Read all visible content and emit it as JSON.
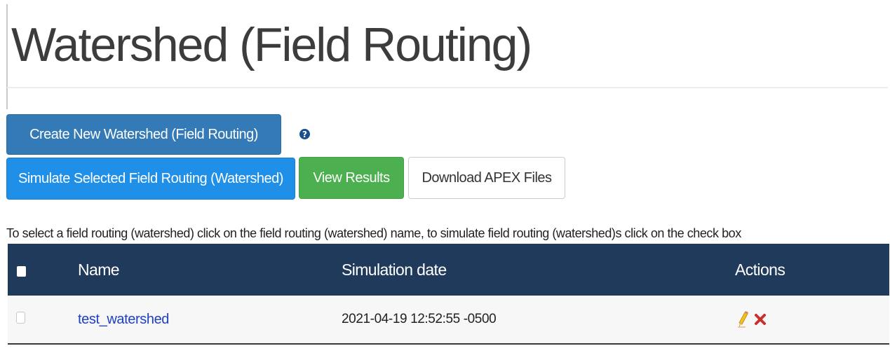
{
  "page": {
    "title": "Watershed (Field Routing)"
  },
  "buttons": {
    "create_label": "Create New Watershed (Field Routing)",
    "simulate_label": "Simulate Selected Field Routing (Watershed)",
    "view_results_label": "View Results",
    "download_label": "Download APEX Files",
    "help_glyph": "?"
  },
  "instructions": "To select a field routing (watershed) click on the field routing (watershed) name, to simulate field routing (watershed)s click on the check box",
  "table": {
    "columns": [
      "",
      "Name",
      "Simulation date",
      "Actions"
    ],
    "rows": [
      {
        "name": "test_watershed",
        "simulation_date": "2021-04-19 12:52:55 -0500",
        "actions": [
          "edit-icon",
          "delete-icon"
        ],
        "checked": false
      }
    ]
  },
  "colors": {
    "primary": "#337ab7",
    "info": "#1f8fe8",
    "success": "#4cb050",
    "table_header": "#1f3a5b",
    "link": "#1d3fc2",
    "delete": "#c9302c"
  }
}
